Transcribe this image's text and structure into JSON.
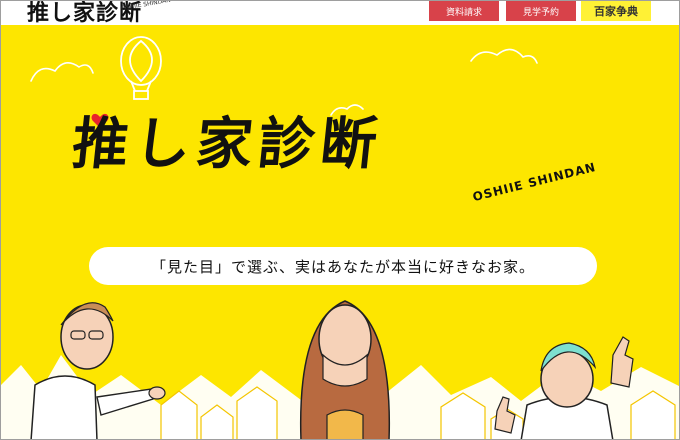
{
  "header": {
    "brand_title": "推し家診断",
    "brand_sub": "OSHIIE SHINDAN",
    "buttons": [
      {
        "label": "資料請求"
      },
      {
        "label": "見学予約"
      },
      {
        "label": "百家争典"
      }
    ]
  },
  "hero": {
    "title": "推し家診断",
    "title_sub": "OSHIIE SHINDAN",
    "tagline": "「見た目」で選ぶ、実はあなたが本当に好きなお家。"
  },
  "colors": {
    "hero_bg": "#fde600",
    "button_red": "#d8424a",
    "button_yellow": "#fff135",
    "heart": "#e8242d"
  }
}
